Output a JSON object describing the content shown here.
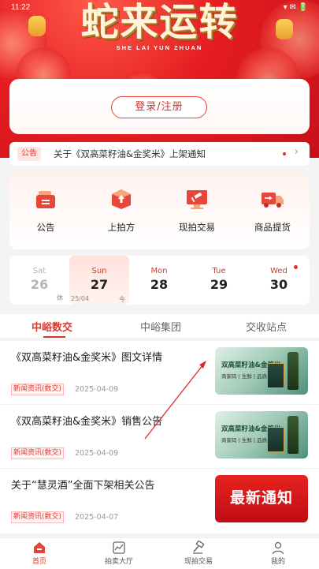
{
  "status_bar": {
    "time": "11:22",
    "right": "▾ ✉ 🔋"
  },
  "brand": {
    "title": "蛇来运转",
    "subtitle": "SHE LAI YUN ZHUAN"
  },
  "login": {
    "button_label": "登录/注册"
  },
  "notice": {
    "tag": "公告",
    "text": "关于《双高菜籽油&金奖米》上架通知"
  },
  "actions": [
    {
      "label": "公告",
      "icon": "announcement-icon"
    },
    {
      "label": "上拍方",
      "icon": "box-upload-icon"
    },
    {
      "label": "现拍交易",
      "icon": "auction-hammer-icon"
    },
    {
      "label": "商品提货",
      "icon": "delivery-truck-icon"
    }
  ],
  "calendar": {
    "days": [
      {
        "weekday": "Sat",
        "day": "26"
      },
      {
        "weekday": "Sun",
        "day": "27",
        "tag_left": "休",
        "tag_mid": "25/04",
        "tag_right": "今"
      },
      {
        "weekday": "Mon",
        "day": "28"
      },
      {
        "weekday": "Tue",
        "day": "29"
      },
      {
        "weekday": "Wed",
        "day": "30"
      }
    ]
  },
  "tabs": [
    {
      "label": "中峪数交"
    },
    {
      "label": "中峪集团"
    },
    {
      "label": "交收站点"
    }
  ],
  "news": [
    {
      "title": "《双高菜籽油&金奖米》图文详情",
      "tag": "新闻资讯(数交)",
      "date": "2025-04-09",
      "thumb_line1": "双高菜籽油&金奖米",
      "thumb_line2": "商家码 | 生鲜 | 品质"
    },
    {
      "title": "《双高菜籽油&金奖米》销售公告",
      "tag": "新闻资讯(数交)",
      "date": "2025-04-09",
      "thumb_line1": "双高菜籽油&金奖米",
      "thumb_line2": "商家码 | 生鲜 | 品质"
    },
    {
      "title": "关于“慧灵酒”全面下架相关公告",
      "tag": "新闻资讯(数交)",
      "date": "2025-04-07",
      "thumb_line1": "最新通知"
    }
  ],
  "bottom_nav": [
    {
      "label": "首页",
      "icon": "home-icon"
    },
    {
      "label": "拍卖大厅",
      "icon": "chart-icon"
    },
    {
      "label": "现拍交易",
      "icon": "hammer-icon"
    },
    {
      "label": "我的",
      "icon": "user-icon"
    }
  ],
  "colors": {
    "brand_red": "#d63a2f",
    "banner_red": "#e51d20"
  }
}
